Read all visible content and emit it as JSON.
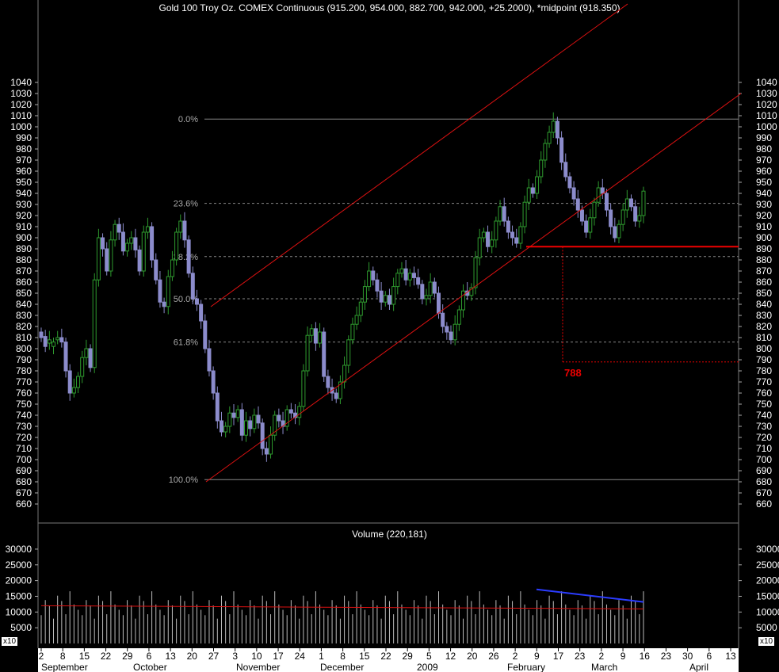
{
  "chart_data": [
    {
      "type": "candlestick",
      "title": "Gold 100 Troy Oz. COMEX Continuous (915.200, 954.000, 882.700, 942.000, +25.2000), *midpoint (918.350)",
      "y_axis_ticks": [
        660,
        670,
        680,
        690,
        700,
        710,
        720,
        730,
        740,
        750,
        760,
        770,
        780,
        790,
        800,
        810,
        820,
        830,
        840,
        850,
        860,
        870,
        880,
        890,
        900,
        910,
        920,
        930,
        940,
        950,
        960,
        970,
        980,
        990,
        1000,
        1010,
        1020,
        1030,
        1040
      ],
      "ylim": [
        655,
        1045
      ],
      "x_tick_labels": [
        "2",
        "8",
        "15",
        "22",
        "29",
        "6",
        "13",
        "20",
        "27",
        "3",
        "10",
        "17",
        "24",
        "1",
        "8",
        "15",
        "22",
        "29",
        "5",
        "12",
        "20",
        "26",
        "2",
        "9",
        "17",
        "23",
        "2",
        "9",
        "16",
        "23",
        "30",
        "6",
        "13"
      ],
      "x_month_labels": [
        "September",
        "October",
        "November",
        "December",
        "2009",
        "February",
        "March",
        "April"
      ],
      "fibonacci_levels": [
        {
          "label": "0.0%",
          "value": 1007
        },
        {
          "label": "23.6%",
          "value": 931
        },
        {
          "label": "38.2%",
          "value": 883
        },
        {
          "label": "50.0%",
          "value": 845
        },
        {
          "label": "61.8%",
          "value": 806
        },
        {
          "label": "100.0%",
          "value": 682
        }
      ],
      "horizontal_support": 892,
      "target_annotation": {
        "label": "788",
        "value": 788
      },
      "price_points": [
        [
          815,
          810
        ],
        [
          811,
          802
        ],
        [
          805,
          808
        ],
        [
          802,
          806
        ],
        [
          808,
          810
        ],
        [
          810,
          806
        ],
        [
          806,
          780
        ],
        [
          780,
          760
        ],
        [
          760,
          765
        ],
        [
          765,
          775
        ],
        [
          775,
          792
        ],
        [
          792,
          800
        ],
        [
          800,
          783
        ],
        [
          783,
          862
        ],
        [
          862,
          900
        ],
        [
          900,
          890
        ],
        [
          890,
          870
        ],
        [
          870,
          898
        ],
        [
          898,
          912
        ],
        [
          912,
          905
        ],
        [
          905,
          888
        ],
        [
          888,
          895
        ],
        [
          895,
          900
        ],
        [
          900,
          889
        ],
        [
          889,
          870
        ],
        [
          870,
          905
        ],
        [
          905,
          910
        ],
        [
          910,
          880
        ],
        [
          880,
          862
        ],
        [
          862,
          842
        ],
        [
          842,
          838
        ],
        [
          838,
          865
        ],
        [
          865,
          880
        ],
        [
          880,
          905
        ],
        [
          905,
          915
        ],
        [
          915,
          898
        ],
        [
          898,
          868
        ],
        [
          868,
          845
        ],
        [
          845,
          840
        ],
        [
          840,
          825
        ],
        [
          825,
          800
        ],
        [
          800,
          780
        ],
        [
          780,
          760
        ],
        [
          760,
          735
        ],
        [
          735,
          725
        ],
        [
          725,
          730
        ],
        [
          730,
          742
        ],
        [
          742,
          738
        ],
        [
          738,
          745
        ],
        [
          745,
          722
        ],
        [
          722,
          735
        ],
        [
          735,
          728
        ],
        [
          728,
          740
        ],
        [
          740,
          733
        ],
        [
          733,
          710
        ],
        [
          710,
          705
        ],
        [
          705,
          722
        ],
        [
          722,
          740
        ],
        [
          740,
          735
        ],
        [
          735,
          730
        ],
        [
          730,
          745
        ],
        [
          745,
          742
        ],
        [
          742,
          738
        ],
        [
          738,
          748
        ],
        [
          748,
          780
        ],
        [
          780,
          812
        ],
        [
          812,
          818
        ],
        [
          818,
          805
        ],
        [
          805,
          815
        ],
        [
          815,
          775
        ],
        [
          775,
          765
        ],
        [
          765,
          760
        ],
        [
          760,
          755
        ],
        [
          755,
          770
        ],
        [
          770,
          785
        ],
        [
          785,
          808
        ],
        [
          808,
          822
        ],
        [
          822,
          830
        ],
        [
          830,
          842
        ],
        [
          842,
          856
        ],
        [
          856,
          870
        ],
        [
          870,
          862
        ],
        [
          862,
          852
        ],
        [
          852,
          842
        ],
        [
          842,
          848
        ],
        [
          848,
          840
        ],
        [
          840,
          856
        ],
        [
          856,
          868
        ],
        [
          868,
          872
        ],
        [
          872,
          862
        ],
        [
          862,
          868
        ],
        [
          868,
          864
        ],
        [
          864,
          858
        ],
        [
          858,
          845
        ],
        [
          845,
          848
        ],
        [
          848,
          860
        ],
        [
          860,
          850
        ],
        [
          850,
          832
        ],
        [
          832,
          820
        ],
        [
          820,
          815
        ],
        [
          815,
          808
        ],
        [
          808,
          822
        ],
        [
          822,
          835
        ],
        [
          835,
          852
        ],
        [
          852,
          848
        ],
        [
          848,
          855
        ],
        [
          855,
          882
        ],
        [
          882,
          900
        ],
        [
          900,
          905
        ],
        [
          905,
          892
        ],
        [
          892,
          898
        ],
        [
          898,
          915
        ],
        [
          915,
          928
        ],
        [
          928,
          915
        ],
        [
          915,
          905
        ],
        [
          905,
          900
        ],
        [
          900,
          895
        ],
        [
          895,
          910
        ],
        [
          910,
          932
        ],
        [
          932,
          945
        ],
        [
          945,
          940
        ],
        [
          940,
          955
        ],
        [
          955,
          970
        ],
        [
          970,
          985
        ],
        [
          985,
          995
        ],
        [
          995,
          1005
        ],
        [
          1005,
          990
        ],
        [
          990,
          968
        ],
        [
          968,
          955
        ],
        [
          955,
          945
        ],
        [
          945,
          935
        ],
        [
          935,
          925
        ],
        [
          925,
          915
        ],
        [
          915,
          905
        ],
        [
          905,
          918
        ],
        [
          918,
          932
        ],
        [
          932,
          945
        ],
        [
          945,
          940
        ],
        [
          940,
          925
        ],
        [
          925,
          910
        ],
        [
          910,
          900
        ],
        [
          900,
          912
        ],
        [
          912,
          925
        ],
        [
          925,
          935
        ],
        [
          935,
          928
        ],
        [
          928,
          915
        ],
        [
          915,
          920
        ],
        [
          920,
          942
        ]
      ]
    },
    {
      "type": "bar",
      "title": "Volume (220,181)",
      "y_axis_ticks": [
        5000,
        10000,
        15000,
        20000,
        25000,
        30000
      ],
      "ylim": [
        0,
        32000
      ],
      "unit_label": "x10",
      "moving_average_level": 12000,
      "trend_line": {
        "start": 17200,
        "end": 13200
      }
    }
  ]
}
